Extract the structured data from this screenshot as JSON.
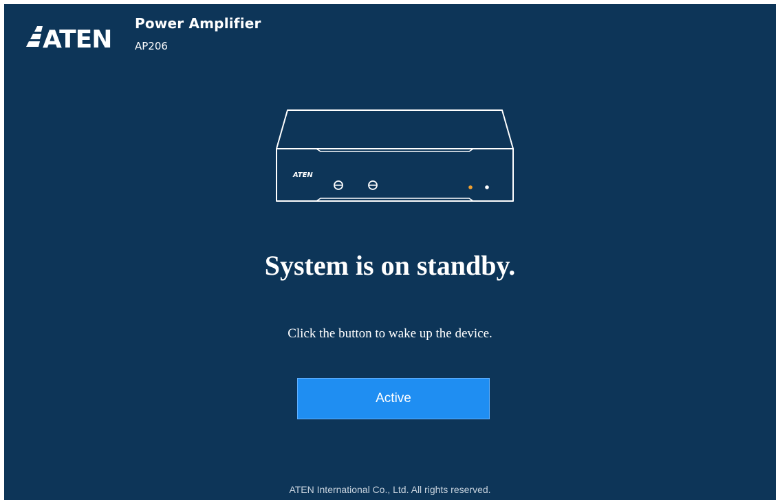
{
  "header": {
    "logo_text": "ATEN",
    "product_name": "Power Amplifier",
    "model": "AP206"
  },
  "device": {
    "front_label": "ATEN",
    "led_colors": [
      "#f0a030",
      "#ffffff"
    ]
  },
  "status": {
    "headline": "System is on standby.",
    "instruction": "Click the button to wake up the device."
  },
  "actions": {
    "active_label": "Active"
  },
  "footer": {
    "copyright": "ATEN International Co., Ltd. All rights reserved."
  },
  "colors": {
    "background": "#0d3558",
    "button": "#1f8ef2"
  }
}
